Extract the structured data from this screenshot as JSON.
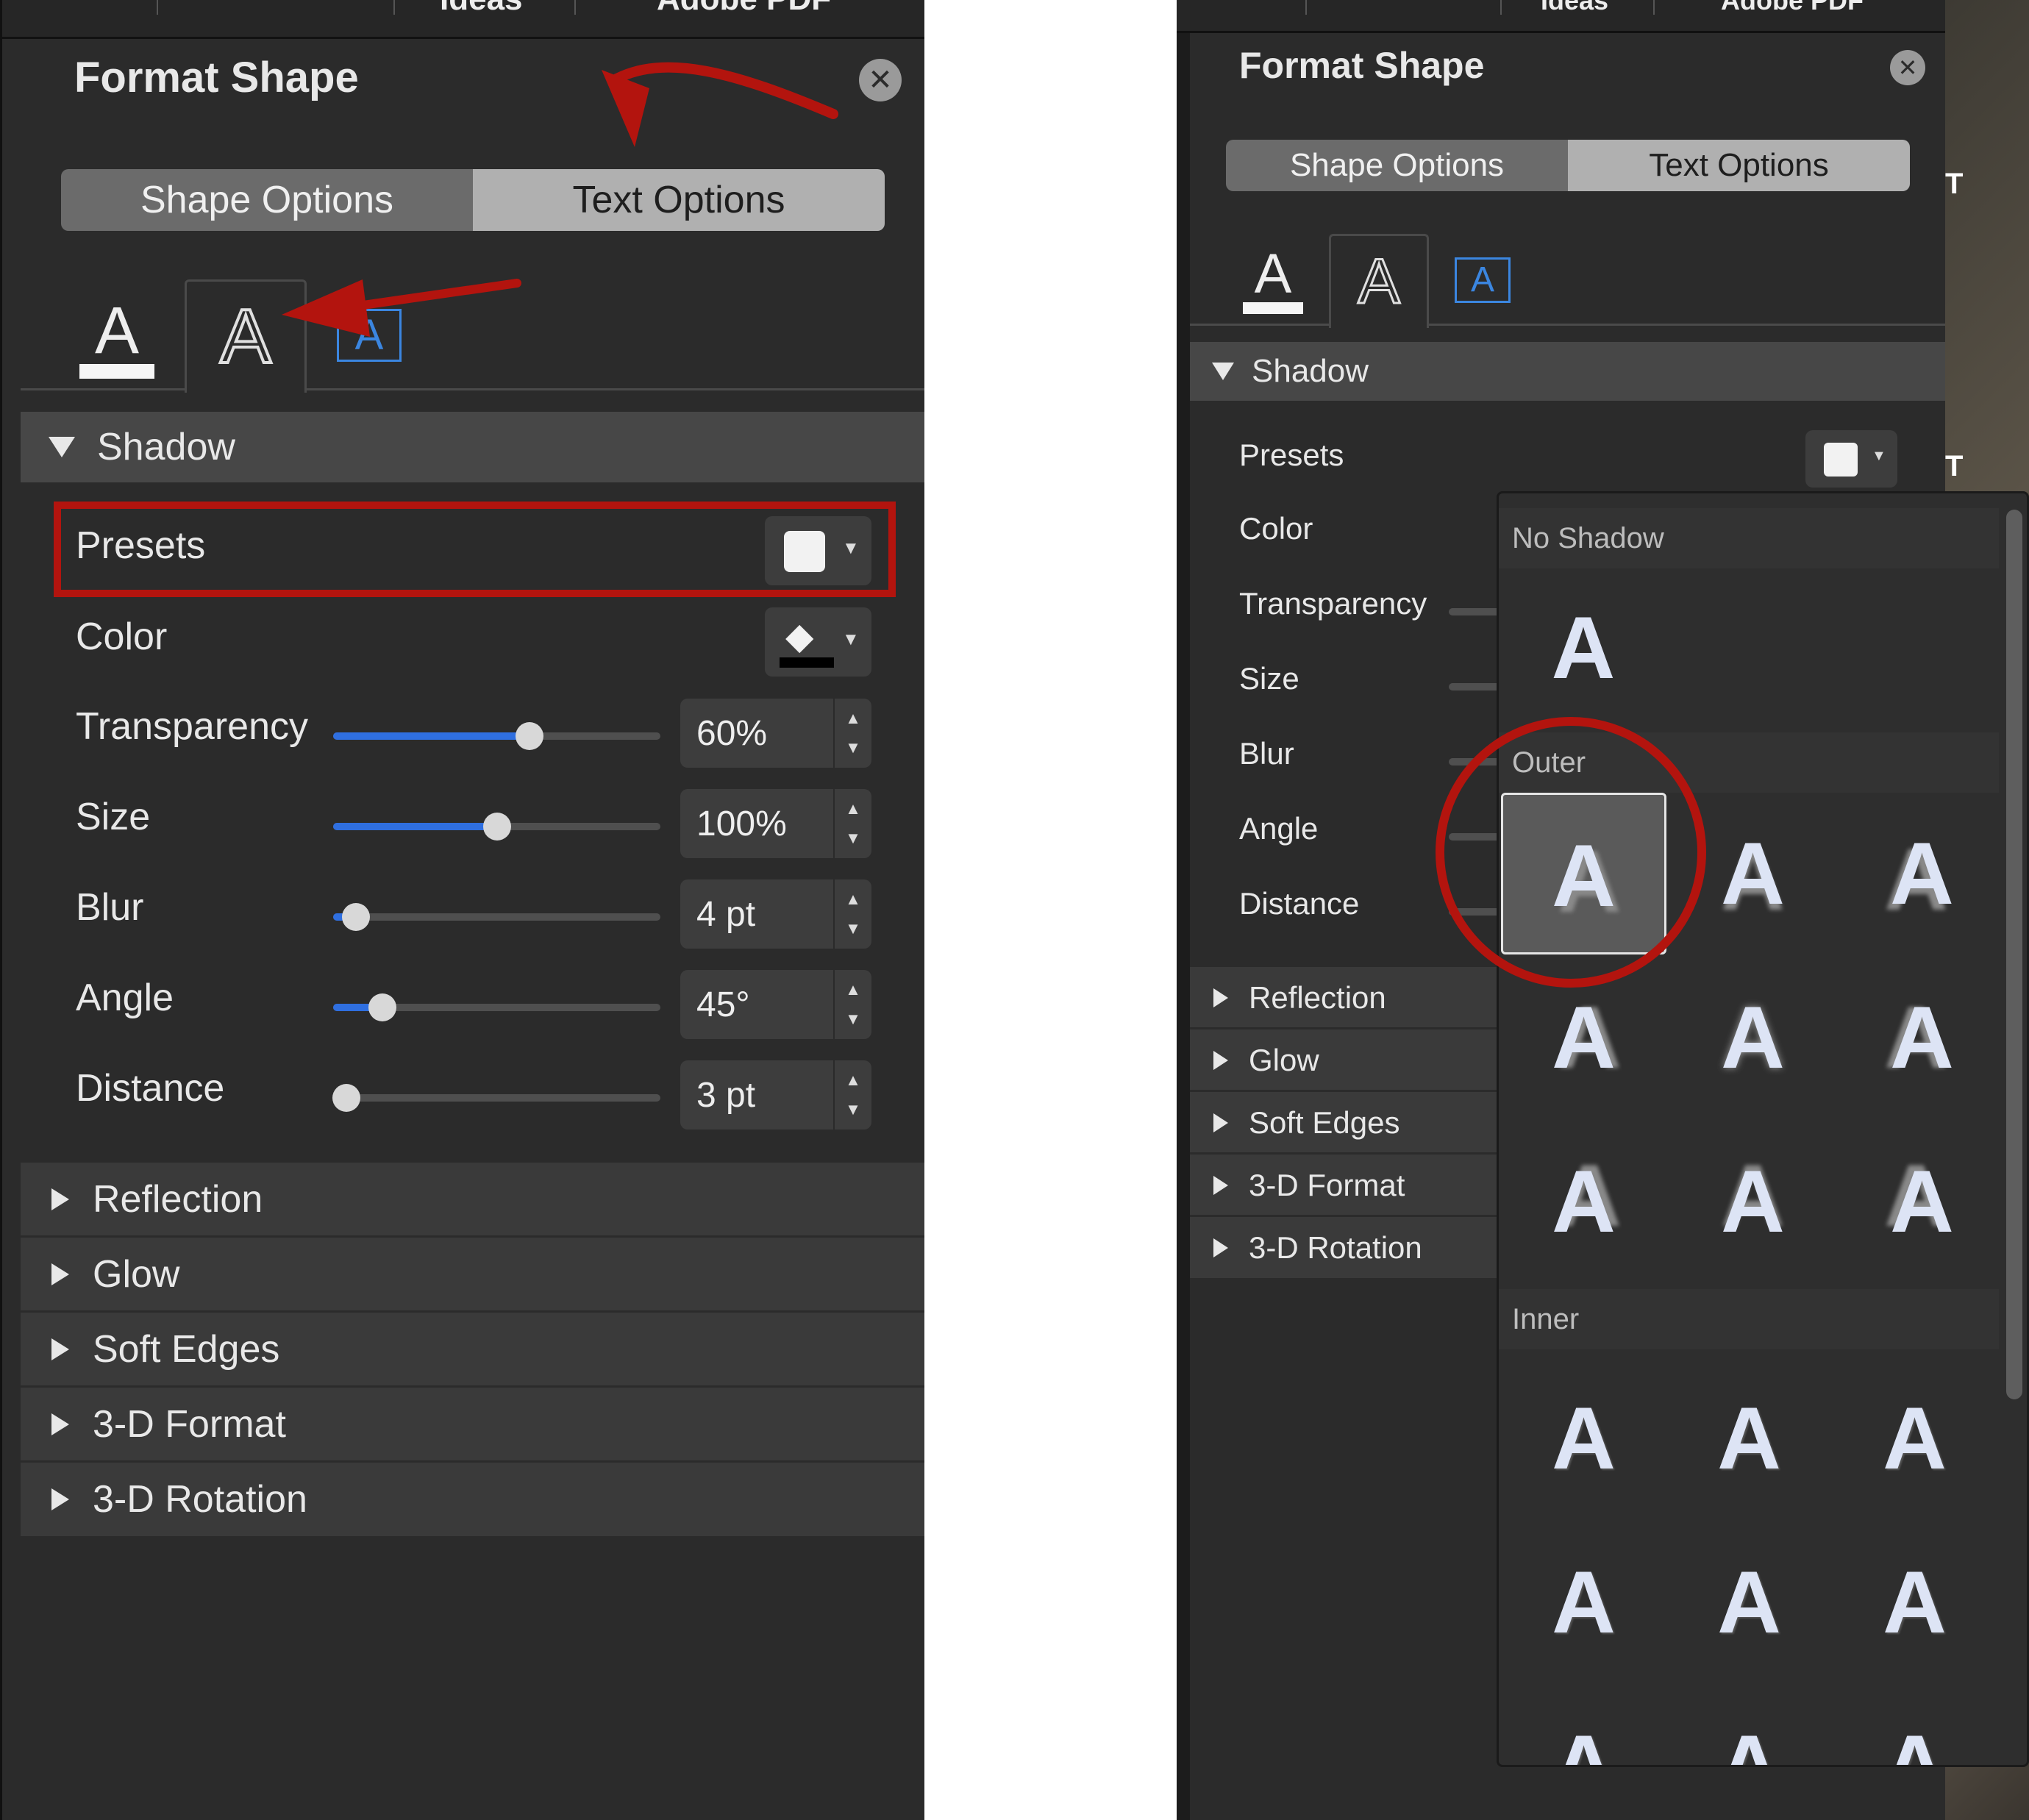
{
  "top_tabs": [
    "Ideas",
    "Adobe PDF"
  ],
  "panel": {
    "title": "Format Shape",
    "close_icon": "close-icon",
    "segments": {
      "shape": "Shape Options",
      "text": "Text Options"
    },
    "subtab_icons": [
      "text-fill-outline-icon",
      "text-effects-icon",
      "textbox-icon"
    ],
    "subtab_letter": "A",
    "shadow": {
      "header": "Shadow",
      "presets_label": "Presets",
      "color_label": "Color",
      "rows": [
        {
          "label": "Transparency",
          "value": "60%",
          "fraction": 0.6
        },
        {
          "label": "Size",
          "value": "100%",
          "fraction": 0.5
        },
        {
          "label": "Blur",
          "value": "4 pt",
          "fraction": 0.07
        },
        {
          "label": "Angle",
          "value": "45°",
          "fraction": 0.15
        },
        {
          "label": "Distance",
          "value": "3 pt",
          "fraction": 0.04
        }
      ]
    },
    "collapsed_sections": [
      "Reflection",
      "Glow",
      "Soft Edges",
      "3-D Format",
      "3-D Rotation"
    ]
  },
  "gallery": {
    "no_shadow": "No Shadow",
    "outer": "Outer",
    "inner": "Inner",
    "letter": "A"
  },
  "background_letters": "T",
  "colors": {
    "accent": "#2f6fe0",
    "annotation": "#b3140e",
    "panel": "#2b2b2b"
  }
}
